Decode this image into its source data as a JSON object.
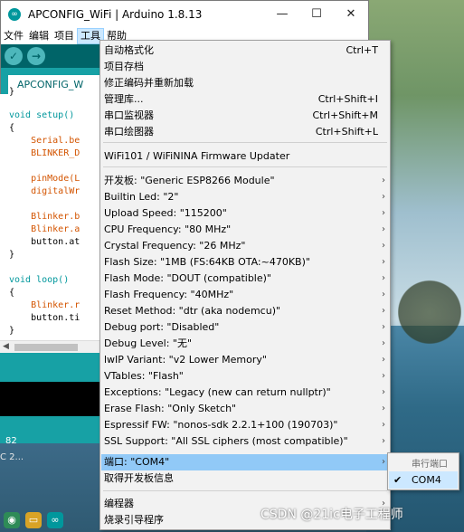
{
  "window": {
    "title": "APCONFIG_WiFi | Arduino 1.8.13",
    "app_icon": "arduino-icon",
    "controls": [
      "—",
      "☐",
      "✕"
    ]
  },
  "menubar": [
    "文件",
    "编辑",
    "项目",
    "工具",
    "帮助"
  ],
  "toolbar": {
    "verify": "✓",
    "upload": "→"
  },
  "tab": {
    "label": "APCONFIG_W"
  },
  "code": [
    "}",
    "",
    "void setup()",
    "{",
    "    Serial.be",
    "    BLINKER_D",
    "",
    "    pinMode(L",
    "    digitalWr",
    "",
    "    Blinker.b",
    "    Blinker.a",
    "    button.at",
    "}",
    "",
    "void loop()",
    "{",
    "    Blinker.r",
    "    button.ti",
    "}"
  ],
  "status": {
    "line": "82",
    "stray": "C 2..."
  },
  "tools_menu": {
    "items": [
      {
        "label": "自动格式化",
        "shortcut": "Ctrl+T"
      },
      {
        "label": "项目存档",
        "shortcut": ""
      },
      {
        "label": "修正编码并重新加载",
        "shortcut": ""
      },
      {
        "label": "管理库...",
        "shortcut": "Ctrl+Shift+I"
      },
      {
        "label": "串口监视器",
        "shortcut": "Ctrl+Shift+M"
      },
      {
        "label": "串口绘图器",
        "shortcut": "Ctrl+Shift+L"
      },
      {
        "label": "WiFi101 / WiFiNINA Firmware Updater",
        "shortcut": ""
      },
      {
        "label": "开发板: \"Generic ESP8266 Module\"",
        "shortcut": ""
      },
      {
        "label": "Builtin Led: \"2\"",
        "shortcut": ""
      },
      {
        "label": "Upload Speed: \"115200\"",
        "shortcut": ""
      },
      {
        "label": "CPU Frequency: \"80 MHz\"",
        "shortcut": ""
      },
      {
        "label": "Crystal Frequency: \"26 MHz\"",
        "shortcut": ""
      },
      {
        "label": "Flash Size: \"1MB (FS:64KB OTA:~470KB)\"",
        "shortcut": ""
      },
      {
        "label": "Flash Mode: \"DOUT (compatible)\"",
        "shortcut": ""
      },
      {
        "label": "Flash Frequency: \"40MHz\"",
        "shortcut": ""
      },
      {
        "label": "Reset Method: \"dtr (aka nodemcu)\"",
        "shortcut": ""
      },
      {
        "label": "Debug port: \"Disabled\"",
        "shortcut": ""
      },
      {
        "label": "Debug Level: \"无\"",
        "shortcut": ""
      },
      {
        "label": "lwIP Variant: \"v2 Lower Memory\"",
        "shortcut": ""
      },
      {
        "label": "VTables: \"Flash\"",
        "shortcut": ""
      },
      {
        "label": "Exceptions: \"Legacy (new can return nullptr)\"",
        "shortcut": ""
      },
      {
        "label": "Erase Flash: \"Only Sketch\"",
        "shortcut": ""
      },
      {
        "label": "Espressif FW: \"nonos-sdk 2.2.1+100 (190703)\"",
        "shortcut": ""
      },
      {
        "label": "SSL Support: \"All SSL ciphers (most compatible)\"",
        "shortcut": ""
      },
      {
        "label": "端口: \"COM4\"",
        "shortcut": ""
      },
      {
        "label": "取得开发板信息",
        "shortcut": ""
      },
      {
        "label": "编程器",
        "shortcut": ""
      },
      {
        "label": "烧录引导程序",
        "shortcut": ""
      }
    ]
  },
  "port_submenu": {
    "header": "串行端口",
    "item": "COM4",
    "check": "✔"
  },
  "watermark": "CSDN @21ic电子工程师",
  "colors": {
    "accent": "#00979c",
    "toolbar": "#006468",
    "highlight": "#91c9f7"
  }
}
